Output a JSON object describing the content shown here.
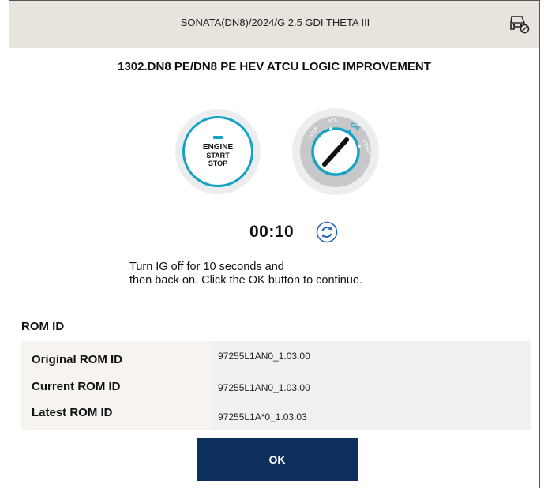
{
  "header": {
    "vehicle": "SONATA(DN8)/2024/G 2.5 GDI THETA III",
    "vehicle_icon": "car-settings-icon"
  },
  "title": "1302.DN8 PE/DN8 PE HEV ATCU LOGIC IMPROVEMENT",
  "engine_button": {
    "line1": "ENGINE",
    "line2": "START",
    "line3": "STOP",
    "accent_color": "#17a3c4"
  },
  "ignition_key": {
    "positions": [
      "LOCK",
      "ACC",
      "ON",
      "START"
    ],
    "active_position": "ON"
  },
  "timer": {
    "value": "00:10",
    "refresh_icon": "refresh-icon"
  },
  "instruction": {
    "line1": "Turn IG off for 10 seconds and",
    "line2": "then back on. Click the OK button to continue."
  },
  "rom": {
    "heading": "ROM ID",
    "rows": [
      {
        "label": "Original ROM ID",
        "value": "97255L1AN0_1.03.00"
      },
      {
        "label": "Current ROM ID",
        "value": "97255L1AN0_1.03.00"
      },
      {
        "label": "Latest ROM ID",
        "value": "97255L1A*0_1.03.03"
      }
    ]
  },
  "ok_button": {
    "label": "OK",
    "color": "#0d2f5e"
  }
}
